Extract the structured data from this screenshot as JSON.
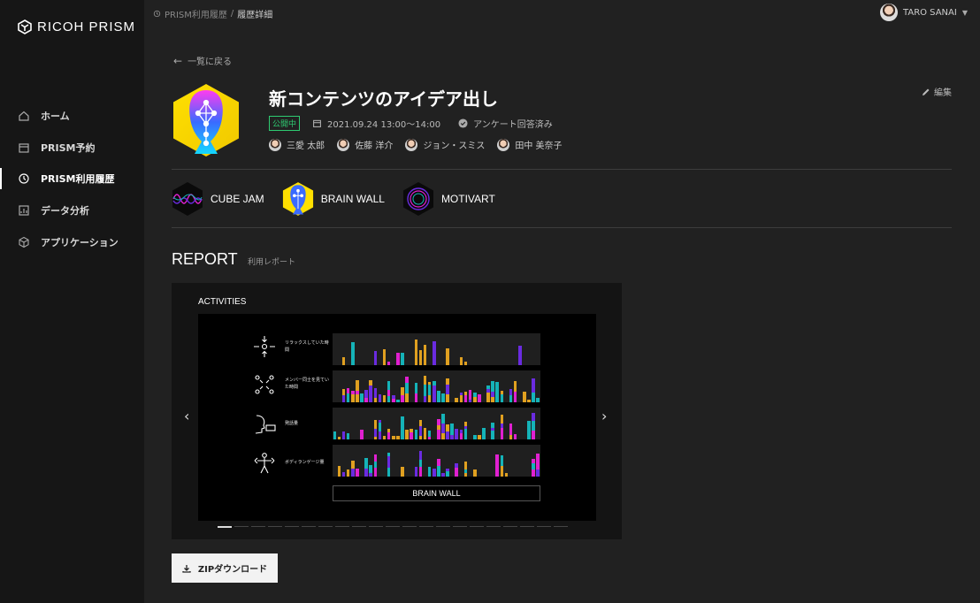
{
  "sidebar": {
    "logo": "RICOH PRISM",
    "items": [
      {
        "label": "ホーム",
        "icon": "home-icon"
      },
      {
        "label": "PRISM予約",
        "icon": "calendar-icon"
      },
      {
        "label": "PRISM利用履歴",
        "icon": "history-icon",
        "active": true
      },
      {
        "label": "データ分析",
        "icon": "chart-icon"
      },
      {
        "label": "アプリケーション",
        "icon": "cube-icon"
      }
    ]
  },
  "breadcrumb": {
    "parent": "PRISM利用履歴",
    "separator": "/",
    "current": "履歴詳細"
  },
  "user": {
    "name": "TARO SANAI"
  },
  "back_label": "一覧に戻る",
  "session": {
    "title": "新コンテンツのアイデア出し",
    "status": "公開中",
    "datetime": "2021.09.24 13:00〜14:00",
    "survey": "アンケート回答済み",
    "edit_label": "編集",
    "members": [
      "三愛 太郎",
      "佐藤 洋介",
      "ジョン・スミス",
      "田中 美奈子"
    ]
  },
  "apps": [
    {
      "name": "CUBE JAM"
    },
    {
      "name": "BRAIN WALL"
    },
    {
      "name": "MOTIVART"
    }
  ],
  "report": {
    "title": "REPORT",
    "subtitle": "利用レポート",
    "panel_title": "ACTIVITIES",
    "rows": [
      {
        "label": "リラックスしていた時間",
        "icon": "relax-icon"
      },
      {
        "label": "メンバー同士を見ていた時間",
        "icon": "gaze-icon"
      },
      {
        "label": "発話量",
        "icon": "speech-icon"
      },
      {
        "label": "ボディランゲージ量",
        "icon": "body-language-icon"
      }
    ],
    "footer_label": "BRAIN WALL",
    "slide_count": 21,
    "active_slide": 1
  },
  "download_label": "ZIPダウンロード",
  "colors": {
    "accent_green": "#2ecb71",
    "bar_purple": "#6a2be0",
    "bar_orange": "#e0a020",
    "bar_teal": "#15b3b8",
    "bar_magenta": "#e020d0"
  }
}
